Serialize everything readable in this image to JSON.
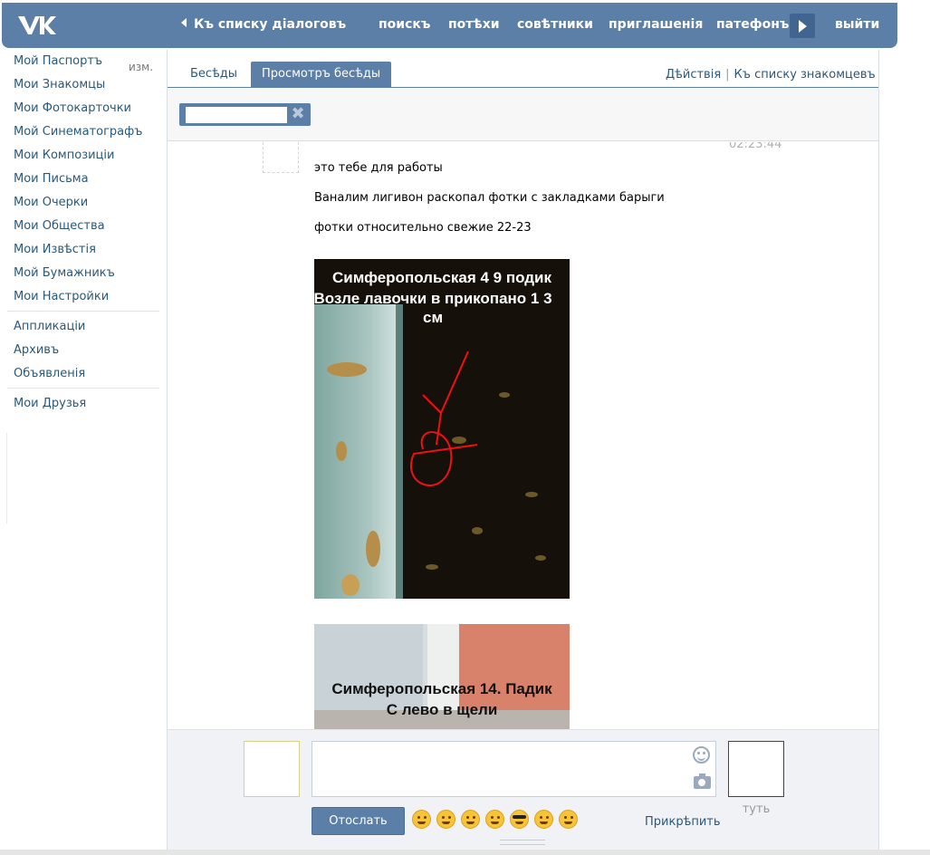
{
  "topbar": {
    "back_label": "Къ списку діалоговъ",
    "nav": [
      "поискъ",
      "потѣхи",
      "совѣтники",
      "приглашенія",
      "патефонъ"
    ],
    "logout_label": "выйти"
  },
  "sidebar": {
    "edit_label": "изм.",
    "group1": [
      "Мой Паспортъ",
      "Мои Знакомцы",
      "Мои Фотокарточки",
      "Мой Синематографъ",
      "Мои Композиціи",
      "Мои Письма",
      "Мои Очерки",
      "Мои Общества",
      "Мои Извѣстія",
      "Мой Бумажникъ",
      "Мои Настройки"
    ],
    "group2": [
      "Аппликаціи",
      "Архивъ",
      "Объявленія"
    ],
    "group3": [
      "Мои Друзья"
    ]
  },
  "tabs": {
    "items": [
      "Бесѣды",
      "Просмотръ бесѣды"
    ],
    "actions_label": "Дѣйствія",
    "contacts_label": "Къ списку знакомцевъ"
  },
  "search": {
    "value": ""
  },
  "message": {
    "time": "02:23:44",
    "lines": [
      "это тебе для работы",
      "Ваналим лигивон раскопал фотки с закладками барыги",
      "фотки относительно свежие 22-23"
    ],
    "photo1_caption": [
      "Симферопольская 4 9 подик",
      "Возле лавочки в прикопано 1 3 см"
    ],
    "photo2_caption": [
      "Симферопольская 14. Падик",
      "С лево в щели"
    ]
  },
  "compose": {
    "send_label": "Отослать",
    "attach_label": "Прикрѣпить",
    "peer_name": "туть"
  },
  "colors": {
    "accent": "#5b7fa6",
    "link": "#2b587a"
  }
}
